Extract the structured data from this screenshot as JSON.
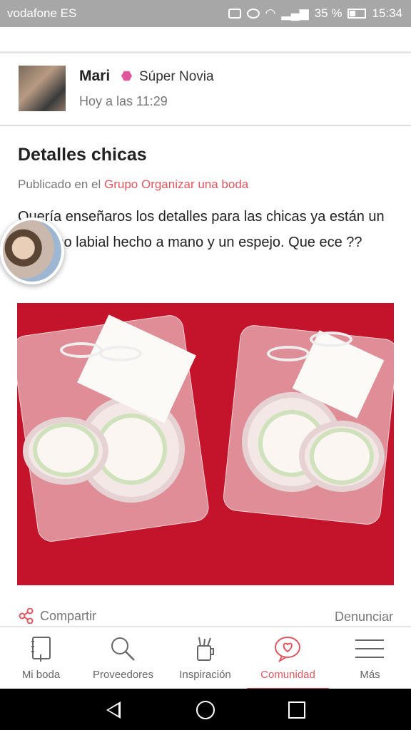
{
  "status_bar": {
    "carrier": "vodafone ES",
    "battery": "35 %",
    "time": "15:34"
  },
  "post": {
    "author": "Mari",
    "badge": "Súper Novia",
    "time": "Hoy a las 11:29",
    "title": "Detalles chicas",
    "published_prefix": "Publicado en el",
    "group_link": "Grupo Organizar una boda",
    "body": "Quería enseñaros los detalles para las chicas ya están un balsamo labial hecho a mano y un espejo. Que ece ??"
  },
  "actions": {
    "share": "Compartir",
    "report": "Denunciar"
  },
  "tabs": [
    {
      "label": "Mi boda",
      "icon": "notebook-icon"
    },
    {
      "label": "Proveedores",
      "icon": "search-icon"
    },
    {
      "label": "Inspiración",
      "icon": "pencil-cup-icon"
    },
    {
      "label": "Comunidad",
      "icon": "heart-bubble-icon",
      "active": true
    },
    {
      "label": "Más",
      "icon": "menu-icon"
    }
  ],
  "colors": {
    "accent": "#e0565f",
    "badge": "#e0559c",
    "status_bar": "#a7a7a7"
  }
}
